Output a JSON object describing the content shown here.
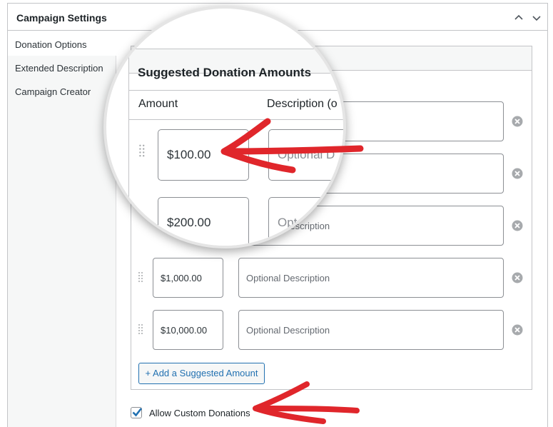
{
  "panel": {
    "title": "Campaign Settings",
    "collapse_up_icon": "chevron-up-icon",
    "collapse_down_icon": "chevron-down-icon"
  },
  "tabs": [
    {
      "label": "Donation Options",
      "active": true
    },
    {
      "label": "Extended Description",
      "active": false
    },
    {
      "label": "Campaign Creator",
      "active": false
    }
  ],
  "suggested": {
    "title": "Suggested Donation Amounts",
    "col_amount": "Amount",
    "col_description": "Description (o",
    "rows": [
      {
        "amount": "$100.00",
        "description": "",
        "placeholder": "Optional Description"
      },
      {
        "amount": "$200.00",
        "description": "",
        "placeholder": "Optional Description"
      },
      {
        "amount": "$1,000.00",
        "description": "",
        "placeholder": "Optional Description"
      },
      {
        "amount": "$10,000.00",
        "description": "",
        "placeholder": "Optional Description"
      }
    ],
    "add_button": "+ Add a Suggested Amount"
  },
  "magnified": {
    "row1_desc_fragment": "Optional D",
    "row2_desc_fragment": "Opt"
  },
  "custom_donations": {
    "label": "Allow Custom Donations",
    "checked": true
  },
  "colors": {
    "annotation_arrow": "#e0262b",
    "link_blue": "#2271b1",
    "border": "#c3c4c7"
  }
}
